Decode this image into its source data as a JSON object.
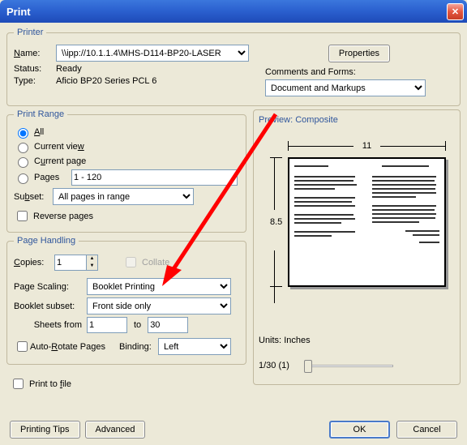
{
  "window": {
    "title": "Print"
  },
  "printer": {
    "legend": "Printer",
    "name_label": "Name:",
    "name_value": "\\\\ipp://10.1.1.4\\MHS-D114-BP20-LASER",
    "status_label": "Status:",
    "status_value": "Ready",
    "type_label": "Type:",
    "type_value": "Aficio BP20 Series PCL 6",
    "properties_btn": "Properties",
    "comments_label": "Comments and Forms:",
    "comments_value": "Document and Markups"
  },
  "print_range": {
    "legend": "Print Range",
    "all": "All",
    "current_view": "Current view",
    "current_page": "Current page",
    "pages_label": "Pages",
    "pages_value": "1 - 120",
    "subset_label": "Subset:",
    "subset_value": "All pages in range",
    "reverse": "Reverse pages"
  },
  "page_handling": {
    "legend": "Page Handling",
    "copies_label": "Copies:",
    "copies_value": "1",
    "collate": "Collate",
    "scaling_label": "Page Scaling:",
    "scaling_value": "Booklet Printing",
    "booklet_subset_label": "Booklet subset:",
    "booklet_subset_value": "Front side only",
    "sheets_from_label": "Sheets from",
    "sheets_from": "1",
    "sheets_to_label": "to",
    "sheets_to": "30",
    "auto_rotate": "Auto-Rotate Pages",
    "binding_label": "Binding:",
    "binding_value": "Left"
  },
  "print_to_file": "Print to file",
  "preview": {
    "title": "Preview: Composite",
    "width": "11",
    "height": "8.5",
    "units_label": "Units:",
    "units_value": "Inches",
    "page_indicator": "1/30 (1)"
  },
  "buttons": {
    "printing_tips": "Printing Tips",
    "advanced": "Advanced",
    "ok": "OK",
    "cancel": "Cancel"
  }
}
